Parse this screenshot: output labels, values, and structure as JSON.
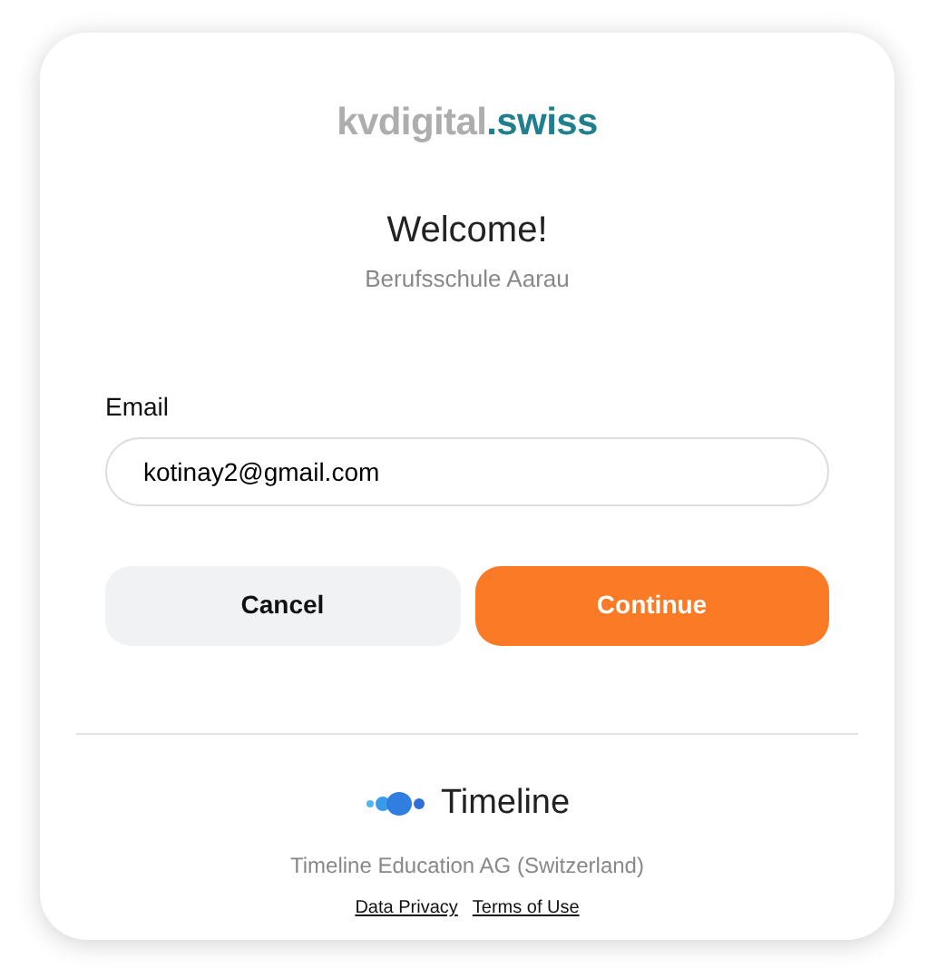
{
  "logo": {
    "text": "kvdigital",
    "accent": ".swiss"
  },
  "title": "Welcome!",
  "subtitle": "Berufsschule Aarau",
  "email": {
    "label": "Email",
    "value": "kotinay2@gmail.com"
  },
  "buttons": [
    {
      "label": "Cancel",
      "kind": "secondary"
    },
    {
      "label": "Continue",
      "kind": "primary"
    }
  ],
  "footer": {
    "brand": "Timeline",
    "company": "Timeline Education AG (Switzerland)",
    "links": [
      "Data Privacy",
      "Terms of Use"
    ]
  }
}
